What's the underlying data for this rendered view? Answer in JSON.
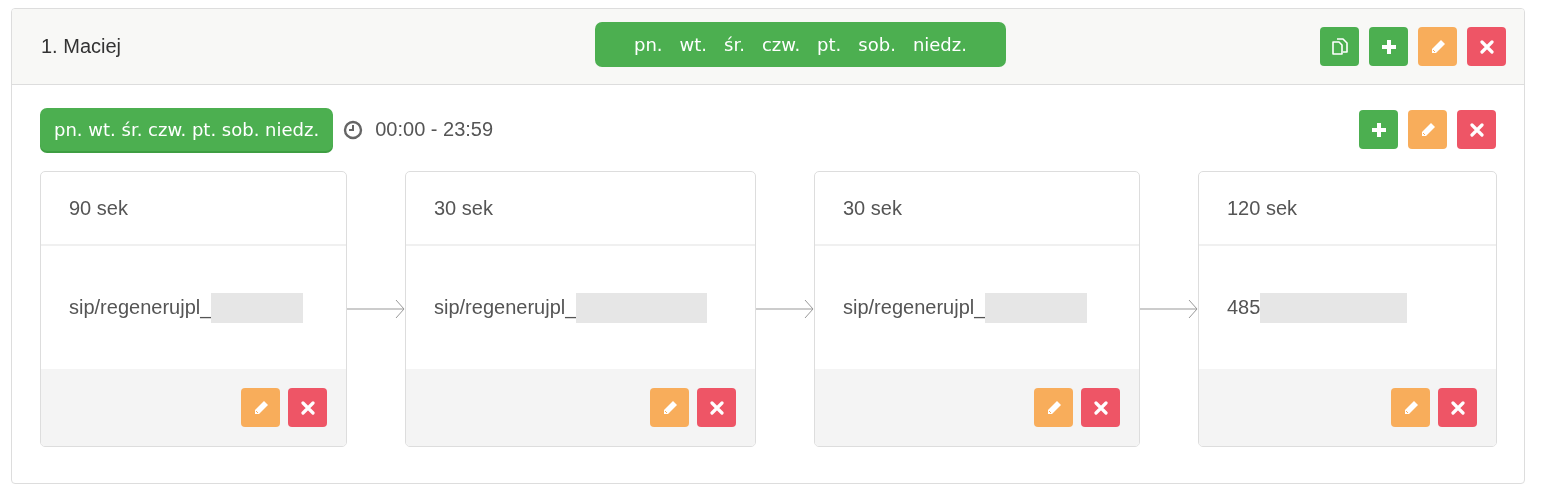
{
  "group": {
    "title": "1. Maciej",
    "days": [
      "pn.",
      "wt.",
      "śr.",
      "czw.",
      "pt.",
      "sob.",
      "niedz."
    ]
  },
  "schedule": {
    "days": "pn. wt. śr. czw. pt. sob. niedz.",
    "time": "00:00 - 23:59"
  },
  "steps": [
    {
      "duration": "90 sek",
      "target": "sip/regenerujpl_",
      "redacted": true
    },
    {
      "duration": "30 sek",
      "target": "sip/regenerujpl_",
      "redacted": true
    },
    {
      "duration": "30 sek",
      "target": "sip/regenerujpl_",
      "redacted": true
    },
    {
      "duration": "120 sek",
      "target": "485",
      "redacted": true
    }
  ]
}
